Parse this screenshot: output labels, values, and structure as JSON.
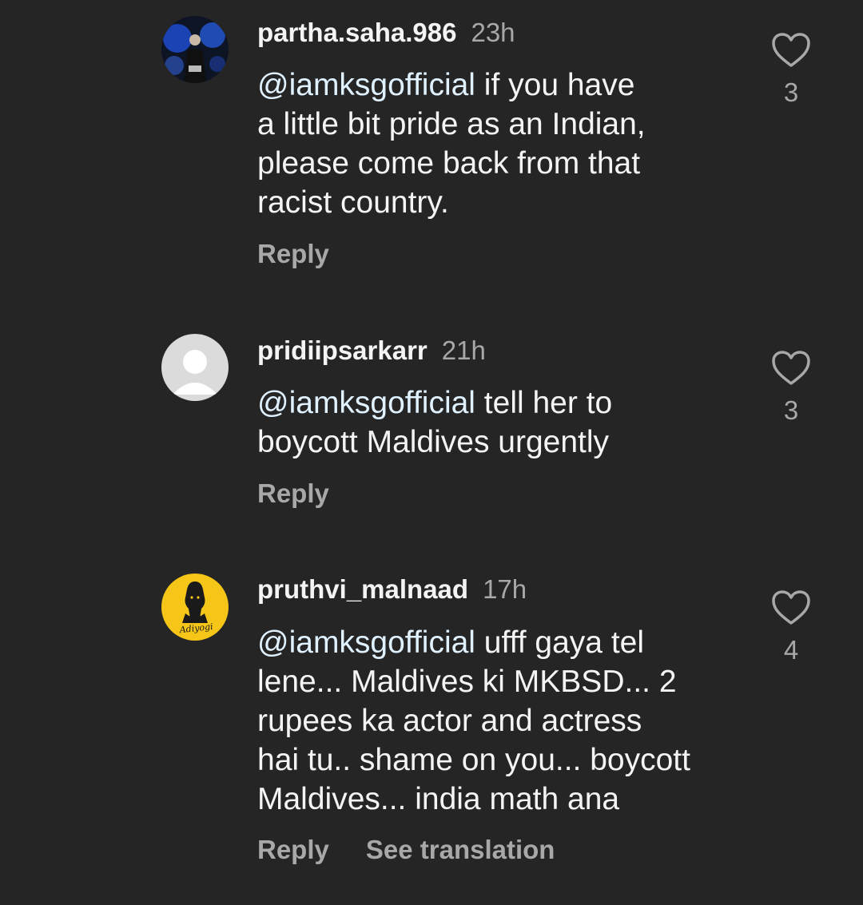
{
  "comments": [
    {
      "username": "partha.saha.986",
      "time": "23h",
      "mention": "@iamksgofficial",
      "lines": [
        " if you have",
        "a little bit pride as an Indian,",
        "please come back from that",
        "racist country."
      ],
      "likes": "3",
      "actions": [
        "Reply"
      ],
      "avatar_icon": "profile-photo-person-blue-light"
    },
    {
      "username": "pridiipsarkarr",
      "time": "21h",
      "mention": "@iamksgofficial",
      "lines": [
        " tell her to",
        "boycott Maldives urgently"
      ],
      "likes": "3",
      "actions": [
        "Reply"
      ],
      "avatar_icon": "default-avatar-icon"
    },
    {
      "username": "pruthvi_malnaad",
      "time": "17h",
      "mention": "@iamksgofficial",
      "lines": [
        " ufff gaya tel",
        "lene... Maldives ki MKBSD... 2",
        "rupees ka actor and actress",
        "hai tu.. shame on you... boycott",
        "Maldives... india math ana"
      ],
      "likes": "4",
      "actions": [
        "Reply",
        "See translation"
      ],
      "avatar_icon": "adiyogi-logo",
      "avatar_text": "Adiyogi"
    }
  ],
  "colors": {
    "background": "#252525",
    "text_primary": "#f4f4f4",
    "text_secondary": "#a8a8a8",
    "avatar_yellow": "#f5c518"
  },
  "icons": {
    "like": "heart-outline-icon"
  }
}
